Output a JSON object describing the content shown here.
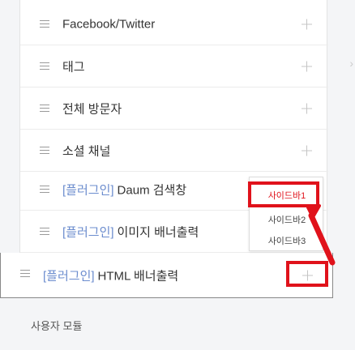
{
  "rows": [
    {
      "label": "Facebook/Twitter"
    },
    {
      "label": "태그"
    },
    {
      "label": "전체 방문자"
    },
    {
      "label": "소셜 채널"
    },
    {
      "plugin_tag": "[플러그인]",
      "label": "Daum 검색창"
    },
    {
      "plugin_tag": "[플러그인]",
      "label": "이미지 배너출력"
    },
    {
      "plugin_tag": "[플러그인]",
      "label": "HTML 배너출력"
    }
  ],
  "dropdown": {
    "items": [
      "사이드바1",
      "사이드바2",
      "사이드바3"
    ]
  },
  "section": {
    "title": "사용자 모듈"
  },
  "colors": {
    "highlight": "#e0121b",
    "plugin": "#6b8cce"
  }
}
